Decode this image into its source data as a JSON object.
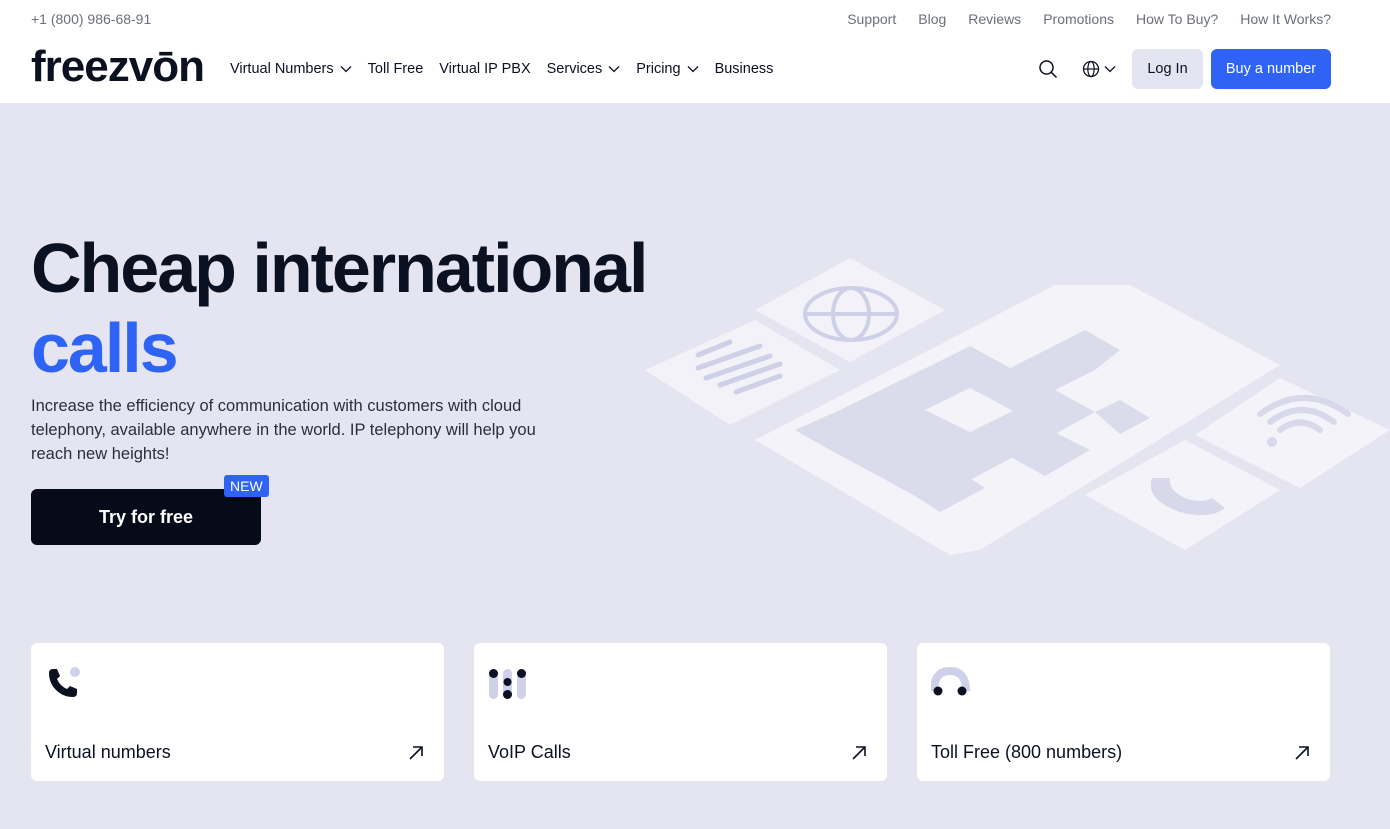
{
  "topbar": {
    "phone": "+1 (800) 986-68-91",
    "links": [
      "Support",
      "Blog",
      "Reviews",
      "Promotions",
      "How To Buy?",
      "How It Works?"
    ]
  },
  "logo": "freezvōn",
  "nav": {
    "items": [
      {
        "label": "Virtual Numbers",
        "dropdown": true
      },
      {
        "label": "Toll Free",
        "dropdown": false
      },
      {
        "label": "Virtual IP PBX",
        "dropdown": false
      },
      {
        "label": "Services",
        "dropdown": true
      },
      {
        "label": "Pricing",
        "dropdown": true
      },
      {
        "label": "Business",
        "dropdown": false
      }
    ],
    "login_label": "Log In",
    "buy_label": "Buy a number"
  },
  "hero": {
    "title_line1": "Cheap international",
    "title_line2": "calls",
    "description": "Increase the efficiency of communication with customers with cloud telephony, available anywhere in the world. IP telephony will help you reach new heights!",
    "cta_label": "Try for free",
    "badge": "NEW"
  },
  "cards": [
    {
      "label": "Virtual numbers",
      "icon": "phone-icon"
    },
    {
      "label": "VoIP Calls",
      "icon": "voip-icon"
    },
    {
      "label": "Toll Free (800 numbers)",
      "icon": "toll-free-icon"
    }
  ],
  "colors": {
    "accent": "#2e63f5",
    "dark": "#050b19",
    "background": "#e4e5f1"
  }
}
